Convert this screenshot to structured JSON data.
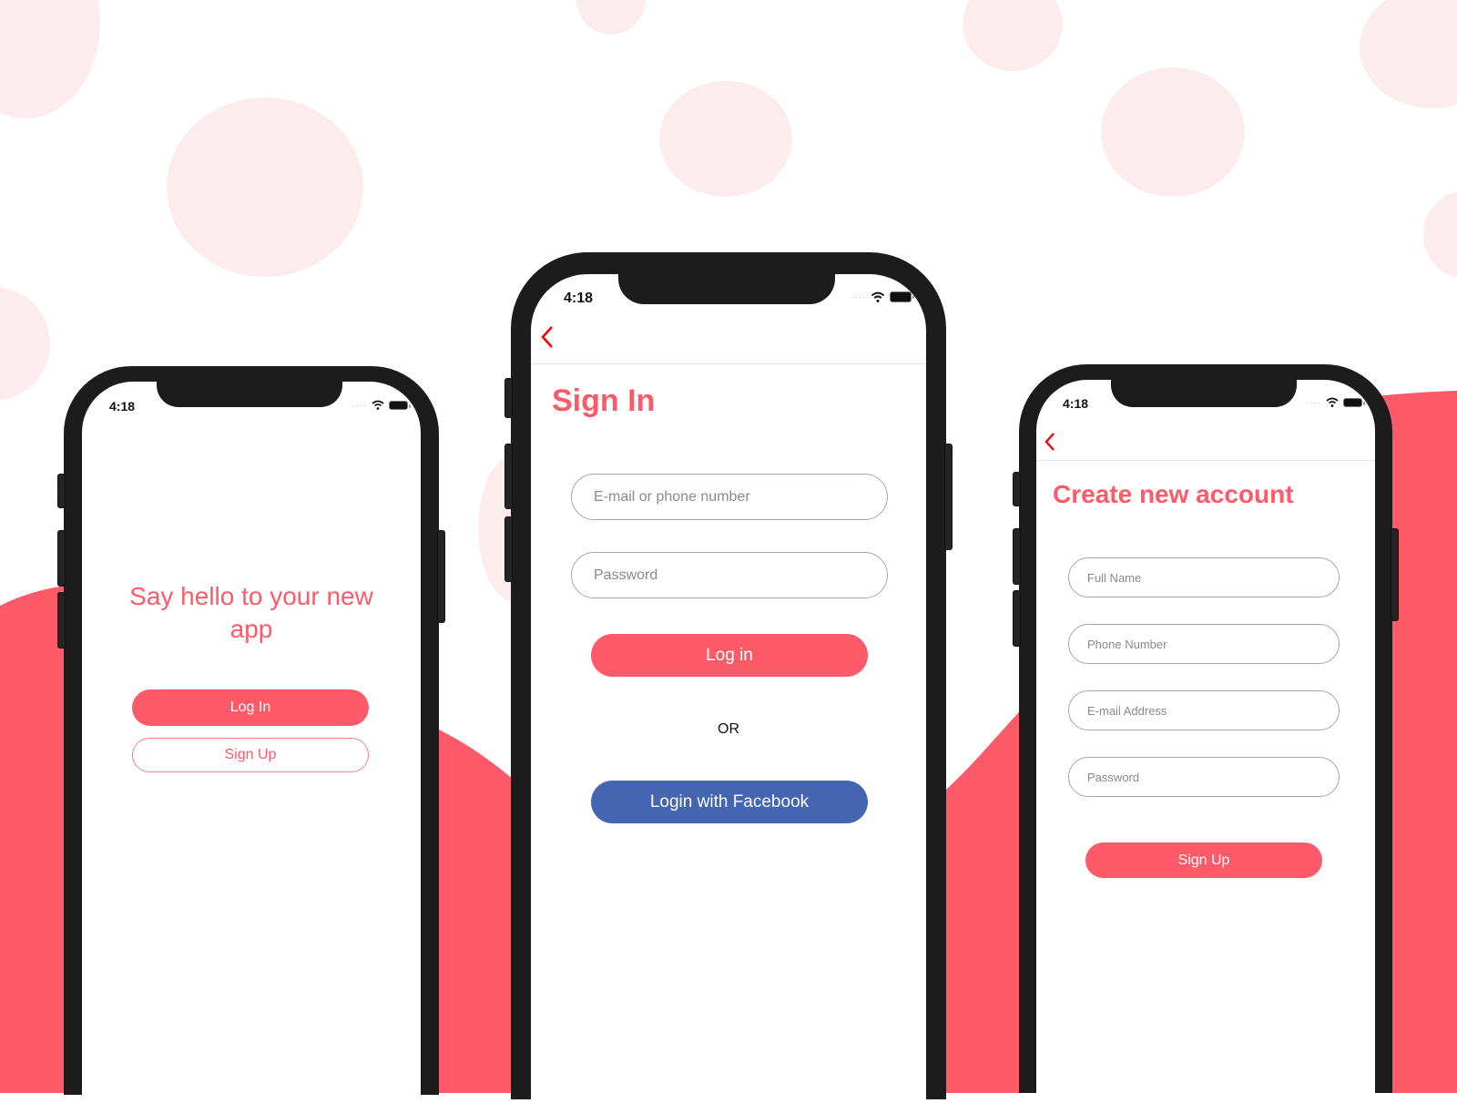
{
  "colors": {
    "accent": "#ff5a69",
    "facebook": "#4365b2",
    "background_dot": "#fdecee",
    "phone_frame": "#1c1c1c",
    "back_icon": "#ff0000"
  },
  "phones": [
    {
      "status": {
        "time": "4:18",
        "icons": [
          "signal-dots-icon",
          "wifi-icon",
          "battery-icon"
        ]
      },
      "screen": "welcome",
      "title": "Say hello to your new app",
      "title_line1": "Say hello to your new",
      "title_line2": "app",
      "buttons": {
        "login": "Log In",
        "signup": "Sign Up"
      }
    },
    {
      "status": {
        "time": "4:18",
        "icons": [
          "signal-dots-icon",
          "wifi-icon",
          "battery-icon"
        ]
      },
      "screen": "sign-in",
      "nav": {
        "back_icon": "chevron-left-icon"
      },
      "title": "Sign In",
      "inputs": [
        {
          "placeholder": "E-mail or phone number",
          "value": ""
        },
        {
          "placeholder": "Password",
          "value": ""
        }
      ],
      "buttons": {
        "login": "Log in",
        "or": "OR",
        "facebook": "Login with Facebook"
      }
    },
    {
      "status": {
        "time": "4:18",
        "icons": [
          "signal-dots-icon",
          "wifi-icon",
          "battery-icon"
        ]
      },
      "screen": "sign-up",
      "nav": {
        "back_icon": "chevron-left-icon"
      },
      "title": "Create new account",
      "inputs": [
        {
          "placeholder": "Full Name",
          "value": ""
        },
        {
          "placeholder": "Phone Number",
          "value": ""
        },
        {
          "placeholder": "E-mail Address",
          "value": ""
        },
        {
          "placeholder": "Password",
          "value": ""
        }
      ],
      "buttons": {
        "signup": "Sign Up"
      }
    }
  ]
}
